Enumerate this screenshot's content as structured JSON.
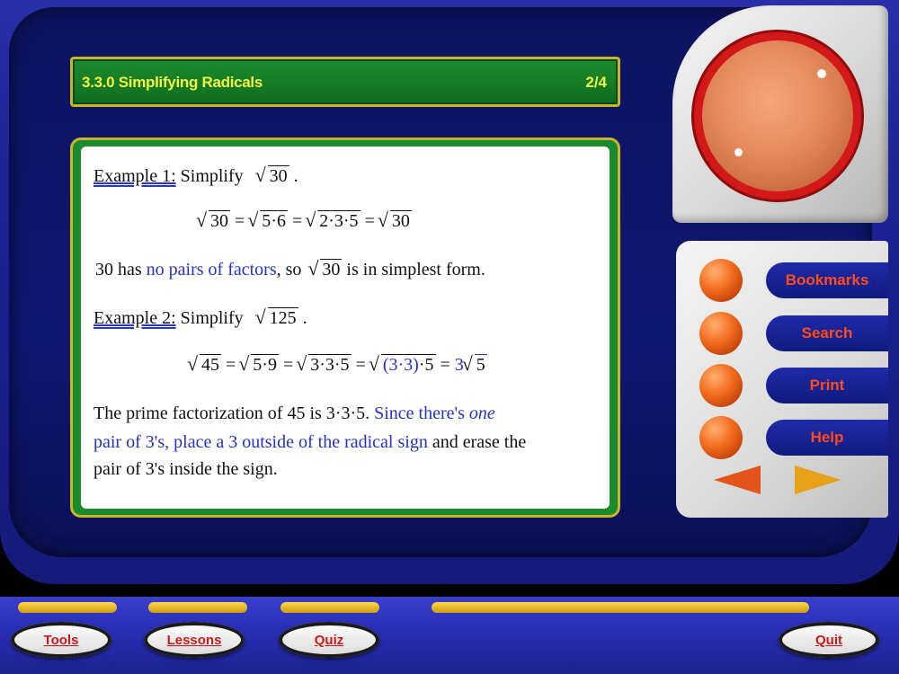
{
  "header": {
    "title": "3.3.0 Simplifying Radicals",
    "page": "2/4"
  },
  "content": {
    "ex1_label": "Example 1:",
    "ex1_instruction": "Simplify",
    "ex1_expr": "30",
    "ex1_period": ".",
    "eq1": {
      "r1": "30",
      "eq": "=",
      "r2": "5·6",
      "r3": "2·3·5",
      "r4": "30"
    },
    "para1_a": "30 has ",
    "para1_b": "no pairs of factors",
    "para1_c": ", so ",
    "para1_r": "30",
    "para1_d": " is in simplest form.",
    "ex2_label": "Example 2:",
    "ex2_instruction": "Simplify",
    "ex2_expr": "125",
    "ex2_period": ".",
    "eq2": {
      "r1": "45",
      "r2": "5·9",
      "r3": "3·3·5",
      "r4a": "(3·3)",
      "r4b": "·5",
      "coef": "3",
      "r5": "5"
    },
    "para2_a": "The prime factorization of 45 is  3·3·5.  ",
    "para2_b": "Since there's ",
    "para2_c": "one",
    "para2_d": "pair of 3's, place a 3 outside of the radical sign",
    "para2_e": " and erase the",
    "para2_f": "pair of 3's inside the sign."
  },
  "menu": {
    "items": [
      {
        "label": "Bookmarks"
      },
      {
        "label": "Search"
      },
      {
        "label": "Print"
      },
      {
        "label": "Help"
      }
    ]
  },
  "bottom": {
    "tools": "Tools",
    "lessons": "Lessons",
    "quiz": "Quiz",
    "quit": "Quit"
  },
  "colors": {
    "title_bar": "#157d26",
    "title_text": "#f1f146",
    "menu_text": "#ff4a1a",
    "highlight_blue": "#2830c8"
  }
}
